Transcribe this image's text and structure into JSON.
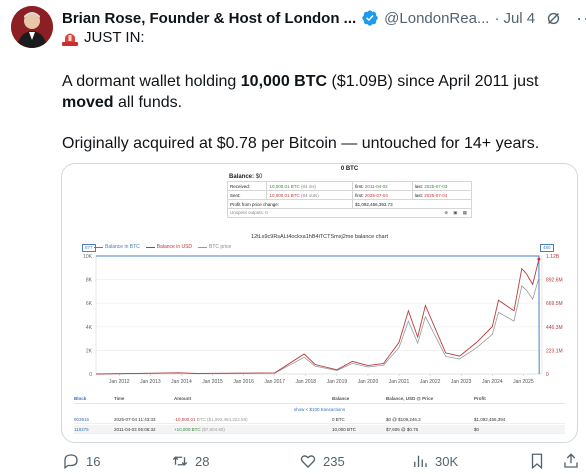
{
  "author": {
    "name": "Brian Rose, Founder & Host of London ...",
    "handle": "@LondonRea...",
    "separator": "·",
    "time": "Jul 4"
  },
  "tweet": {
    "tag": "JUST IN:",
    "p1_a": "A dormant wallet holding ",
    "p1_b": "10,000 BTC",
    "p1_c": " ($1.09B) since April 2011 just ",
    "p1_d": "moved",
    "p1_e": " all funds.",
    "p2": "Originally acquired at $0.78 per Bitcoin — untouched for 14+ years."
  },
  "media": {
    "summary": {
      "title": "0 BTC",
      "balance_label": "Balance:",
      "balance_value": "$0",
      "received_label": "Received:",
      "received_amount": "10,000.01",
      "received_units": "BTC",
      "received_ins": "(84 ins)",
      "received_first_label": "first:",
      "received_first": "2011-04-02",
      "received_last_label": "last:",
      "received_last": "2025-07-03",
      "sent_label": "Sent:",
      "sent_amount": "10,000.01",
      "sent_units": "BTC",
      "sent_outs": "(84 outs)",
      "sent_first_label": "first:",
      "sent_first": "2025-07-04",
      "sent_last_label": "last:",
      "sent_last": "2025-07-04",
      "profit_label": "Profit from price change:",
      "profit_value": "$1,092,456,393.73",
      "unspent": "Unspent outputs: 0"
    },
    "chart_title": "12tLs9c9RsALt4ockxa1hB4iTCTSmxj2me balance chart",
    "legend": {
      "btc_balance": "Balance in BTC",
      "usd_balance": "Balance in USD",
      "btc_price": "BTC price",
      "left_box": "877",
      "right_box": "480"
    },
    "transactions": {
      "headers": [
        "Block",
        "Time",
        "Amount",
        "Balance",
        "Balance, USD @ Price",
        "Profit"
      ],
      "show_more": "show < $100 transactions",
      "rows": [
        {
          "block": "903915",
          "time": "2025-07-04 11:43:33",
          "amount": "-10,000.01",
          "amount_suffix": "BTC ($1,092,464,322.58)",
          "balance": "0 BTC",
          "usd_price": "$0 @ $109,246.3",
          "profit": "$1,092,456,394",
          "amount_color": "#c13a3a"
        },
        {
          "block": "118375",
          "time": "2011-04-03 05:06:32",
          "amount": "+10,000 BTC",
          "amount_suffix": "($7,604.80)",
          "balance": "10,000 BTC",
          "usd_price": "$7,605 @ $0.76",
          "profit": "$0",
          "amount_color": "#3c8a3c"
        }
      ]
    }
  },
  "chart_data": {
    "type": "line",
    "title": "12tLs9c9RsALt4ockxa1hB4iTCTSmxj2me balance chart",
    "x_ticks": [
      "Jan 2012",
      "Jan 2013",
      "Jan 2014",
      "Jan 2015",
      "Jan 2016",
      "Jan 2017",
      "Jan 2018",
      "Jan 2019",
      "Jan 2020",
      "Jan 2021",
      "Jan 2022",
      "Jan 2023",
      "Jan 2024",
      "Jan 2025"
    ],
    "y_left_ticks": [
      "10K",
      "8K",
      "6K",
      "4K",
      "2K",
      "0"
    ],
    "y_right_ticks": [
      "1.12B",
      "892.6M",
      "669.5M",
      "446.3M",
      "223.1M",
      "0"
    ],
    "ylim_left": [
      0,
      10000
    ],
    "ylim_right": [
      0,
      1120000000
    ],
    "series": [
      {
        "name": "Balance in BTC",
        "color": "#4a7fc0",
        "x": [
          2011.25,
          2025.5,
          2025.51
        ],
        "y": [
          10000,
          10000,
          0
        ]
      },
      {
        "name": "Balance in USD",
        "color": "#b83b3b",
        "x": [
          2011.25,
          2013.9,
          2014.5,
          2017.0,
          2017.95,
          2018.3,
          2019.0,
          2019.5,
          2020.0,
          2020.5,
          2021.0,
          2021.3,
          2021.6,
          2021.85,
          2022.5,
          2022.95,
          2023.5,
          2024.0,
          2024.2,
          2024.7,
          2024.95,
          2025.1,
          2025.3,
          2025.5
        ],
        "y": [
          0,
          11000000,
          6000000,
          10000000,
          190000000,
          90000000,
          40000000,
          120000000,
          80000000,
          100000000,
          300000000,
          600000000,
          350000000,
          650000000,
          200000000,
          170000000,
          300000000,
          450000000,
          700000000,
          600000000,
          1000000000,
          950000000,
          850000000,
          1090000000
        ]
      },
      {
        "name": "BTC price",
        "color": "#999999",
        "x": [
          2011.25,
          2013.9,
          2014.5,
          2017.0,
          2017.95,
          2018.3,
          2019.0,
          2019.5,
          2020.0,
          2020.5,
          2021.0,
          2021.3,
          2021.6,
          2021.85,
          2022.5,
          2022.95,
          2023.5,
          2024.0,
          2024.2,
          2024.7,
          2024.95,
          2025.1,
          2025.3,
          2025.5
        ],
        "y": [
          0.78,
          1100,
          600,
          1000,
          19000,
          9000,
          4000,
          12000,
          8000,
          10000,
          30000,
          60000,
          35000,
          65000,
          20000,
          17000,
          30000,
          45000,
          70000,
          60000,
          100000,
          95000,
          85000,
          109000
        ]
      }
    ]
  },
  "actions": {
    "replies": "16",
    "reposts": "28",
    "likes": "235",
    "views": "30K"
  },
  "colors": {
    "text": "#0f1419",
    "muted": "#536471",
    "verified": "#1d9bf0",
    "border": "#cfd9de"
  }
}
